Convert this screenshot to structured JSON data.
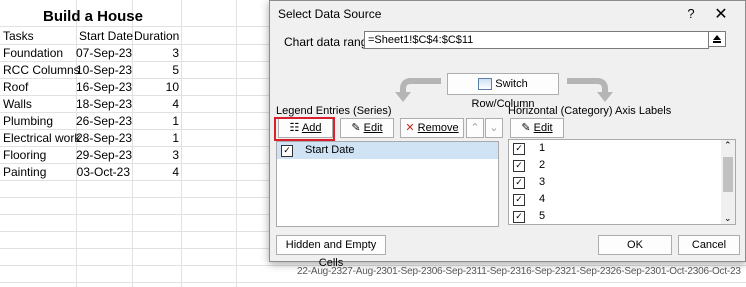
{
  "sheet": {
    "title": "Build a House",
    "headers": [
      "Tasks",
      "Start Date",
      "Duration"
    ],
    "rows": [
      [
        "Foundation",
        "07-Sep-23",
        "3"
      ],
      [
        "RCC Columns",
        "10-Sep-23",
        "5"
      ],
      [
        "Roof",
        "16-Sep-23",
        "10"
      ],
      [
        "Walls",
        "18-Sep-23",
        "4"
      ],
      [
        "Plumbing",
        "26-Sep-23",
        "1"
      ],
      [
        "Electrical work",
        "28-Sep-23",
        "1"
      ],
      [
        "Flooring",
        "29-Sep-23",
        "3"
      ],
      [
        "Painting",
        "03-Oct-23",
        "4"
      ]
    ],
    "chart_axis_dates": "22-Aug-2327-Aug-2301-Sep-2306-Sep-2311-Sep-2316-Sep-2321-Sep-2326-Sep-2301-Oct-2306-Oct-23"
  },
  "dialog": {
    "title": "Select Data Source",
    "help": "?",
    "close": "✕",
    "chart_range_label": "Chart data range:",
    "chart_range_value": "=Sheet1!$C$4:$C$11",
    "switch_label": "Switch Row/Column",
    "legend_label": "Legend Entries (Series)",
    "axis_label": "Horizontal (Category) Axis Labels",
    "add_label": "Add",
    "edit_label": "Edit",
    "remove_label": "Remove",
    "axis_edit_label": "Edit",
    "series": [
      {
        "name": "Start Date",
        "checked": true
      }
    ],
    "categories": [
      {
        "label": "1",
        "checked": true
      },
      {
        "label": "2",
        "checked": true
      },
      {
        "label": "3",
        "checked": true
      },
      {
        "label": "4",
        "checked": true
      },
      {
        "label": "5",
        "checked": true
      }
    ],
    "hidden_cells_label": "Hidden and Empty Cells",
    "ok_label": "OK",
    "cancel_label": "Cancel",
    "highlight_color": "#d8202f"
  }
}
